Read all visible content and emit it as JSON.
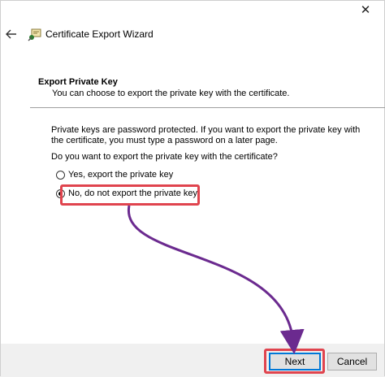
{
  "window": {
    "title": "Certificate Export Wizard",
    "close_glyph": "✕"
  },
  "section": {
    "heading": "Export Private Key",
    "subheading": "You can choose to export the private key with the certificate."
  },
  "body": {
    "paragraph": "Private keys are password protected. If you want to export the private key with the certificate, you must type a password on a later page.",
    "question": "Do you want to export the private key with the certificate?"
  },
  "options": [
    {
      "label": "Yes, export the private key",
      "selected": false
    },
    {
      "label": "No, do not export the private key",
      "selected": true
    }
  ],
  "buttons": {
    "next": "Next",
    "cancel": "Cancel"
  },
  "annotations": {
    "highlight_color": "#e0444e",
    "arrow_color": "#6b2a8f"
  },
  "icons": {
    "back": "back-arrow-icon",
    "wizard": "certificate-wizard-icon",
    "close": "close-icon"
  }
}
